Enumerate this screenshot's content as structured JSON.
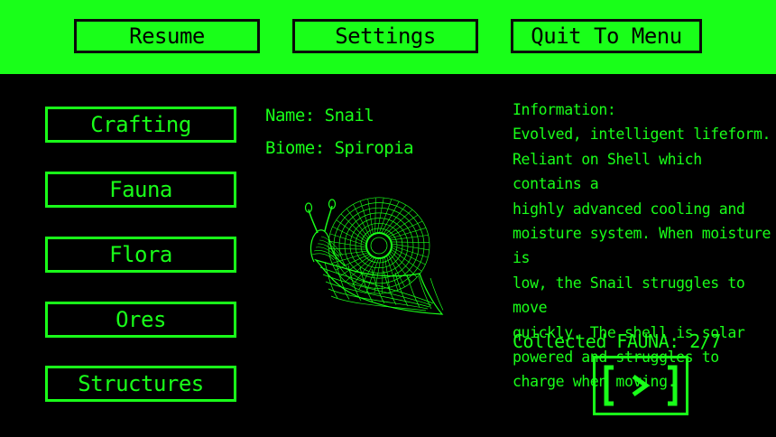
{
  "top_menu": {
    "resume": "Resume",
    "settings": "Settings",
    "quit": "Quit To Menu"
  },
  "categories": [
    "Crafting",
    "Fauna",
    "Flora",
    "Ores",
    "Structures"
  ],
  "entry": {
    "name_line": "Name: Snail",
    "biome_line": "Biome: Spiropia",
    "image_icon": "snail-wireframe-icon"
  },
  "information": {
    "heading": "Information:",
    "lines": [
      "Evolved, intelligent lifeform.",
      "Reliant on Shell which contains a",
      "highly advanced cooling and",
      "moisture system. When moisture is",
      "low, the Snail struggles to move",
      "quickly. The shell is solar",
      "powered and struggles to",
      "charge when moving."
    ]
  },
  "collected": "Collected FAUNA: 2/7",
  "next_button_icon": "next-arrow-icon",
  "colors": {
    "accent": "#19ff19",
    "background": "#000000",
    "button_text_on_accent": "#000000"
  }
}
